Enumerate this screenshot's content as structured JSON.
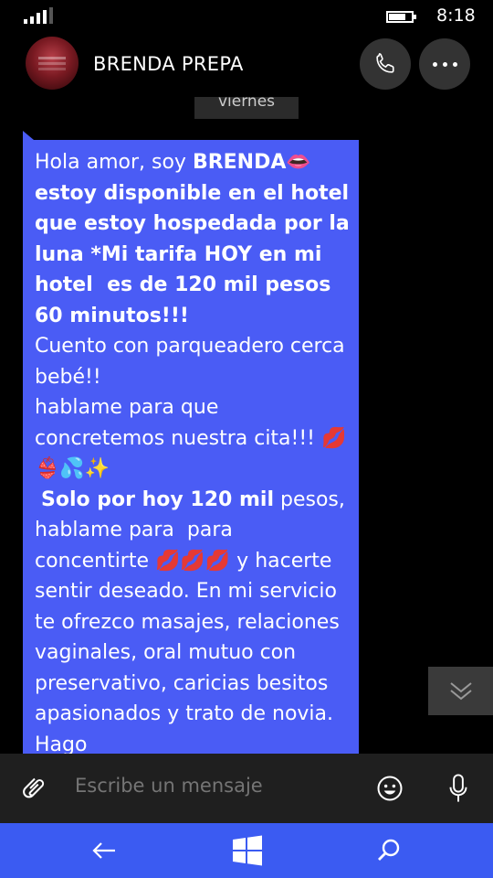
{
  "status_bar": {
    "time": "8:18",
    "signal_bars": 4,
    "battery_level": 0.75
  },
  "header": {
    "contact_name": "BRENDA PREPA",
    "call_icon": "phone-icon",
    "more_icon": "more-dots-icon"
  },
  "conversation": {
    "day_label": "viernes",
    "message_html": "Hola amor, soy <b>BRENDA</b>👄<br><b>estoy disponible en el hotel que estoy hospedada por la luna *Mi tarifa HOY en mi hotel&nbsp; es de 120 mil pesos 60 minutos!!!</b><br>Cuento con parqueadero cerca bebé!!<br>hablame para que concretemos nuestra cita!!! 💋<br>👙💦✨<br>&nbsp;<b>Solo por hoy 120 mil</b> pesos, hablame para&nbsp; para concentirte 💋💋💋 y hacerte sentir deseado. En mi servicio te ofrezco masajes, relaciones vaginales, oral mutuo con preservativo, caricias besitos apasionados y trato de novia. Hago"
  },
  "compose": {
    "placeholder": "Escribe un mensaje",
    "attach_icon": "paperclip-icon",
    "emoji_icon": "emoji-icon",
    "mic_icon": "microphone-icon"
  },
  "navbar": {
    "back_icon": "back-arrow-icon",
    "home_icon": "windows-logo-icon",
    "search_icon": "search-icon"
  },
  "colors": {
    "bubble": "#4a5cf5",
    "navbar": "#3b5bf2",
    "compose_bg": "#1f1f1f"
  }
}
